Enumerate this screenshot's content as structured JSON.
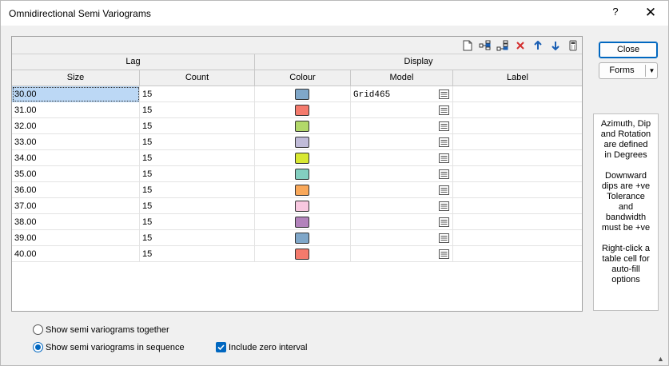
{
  "window": {
    "title": "Omnidirectional Semi Variograms",
    "help_glyph": "?",
    "close_glyph": "✕"
  },
  "toolbar": {
    "icons": [
      "new-document-icon",
      "insert-row-icon",
      "append-row-icon",
      "delete-icon",
      "move-up-icon",
      "move-down-icon",
      "calculator-icon"
    ],
    "delete_color": "#d32f2f",
    "arrow_color": "#1a5fb4"
  },
  "grid": {
    "group_headers": {
      "lag": "Lag",
      "display": "Display"
    },
    "columns": {
      "size": "Size",
      "count": "Count",
      "colour": "Colour",
      "model": "Model",
      "label": "Label"
    },
    "rows": [
      {
        "size": "30.00",
        "count": "15",
        "colour": "#7fa7c9",
        "model": "Grid465",
        "label": ""
      },
      {
        "size": "31.00",
        "count": "15",
        "colour": "#f47a6c",
        "model": "",
        "label": ""
      },
      {
        "size": "32.00",
        "count": "15",
        "colour": "#b2d86a",
        "model": "",
        "label": ""
      },
      {
        "size": "33.00",
        "count": "15",
        "colour": "#c0bbd8",
        "model": "",
        "label": ""
      },
      {
        "size": "34.00",
        "count": "15",
        "colour": "#d8e832",
        "model": "",
        "label": ""
      },
      {
        "size": "35.00",
        "count": "15",
        "colour": "#83cfc0",
        "model": "",
        "label": ""
      },
      {
        "size": "36.00",
        "count": "15",
        "colour": "#f9a85a",
        "model": "",
        "label": ""
      },
      {
        "size": "37.00",
        "count": "15",
        "colour": "#f8c8e0",
        "model": "",
        "label": ""
      },
      {
        "size": "38.00",
        "count": "15",
        "colour": "#b282bb",
        "model": "",
        "label": ""
      },
      {
        "size": "39.00",
        "count": "15",
        "colour": "#7fa7c9",
        "model": "",
        "label": ""
      },
      {
        "size": "40.00",
        "count": "15",
        "colour": "#f47a6c",
        "model": "",
        "label": ""
      }
    ]
  },
  "buttons": {
    "close": "Close",
    "forms": "Forms"
  },
  "info": {
    "p1": [
      "Azimuth, Dip",
      "and Rotation",
      "are defined",
      "in Degrees"
    ],
    "p2": [
      "Downward",
      "dips are +ve",
      "Tolerance",
      "and",
      "bandwidth",
      "must be +ve"
    ],
    "p3": [
      "Right-click a",
      "table cell for",
      "auto-fill",
      "options"
    ]
  },
  "options": {
    "together": "Show semi variograms together",
    "sequence": "Show semi variograms in sequence",
    "include_zero": "Include zero interval",
    "selected": "sequence",
    "include_zero_checked": true
  },
  "accent": "#0067c0"
}
